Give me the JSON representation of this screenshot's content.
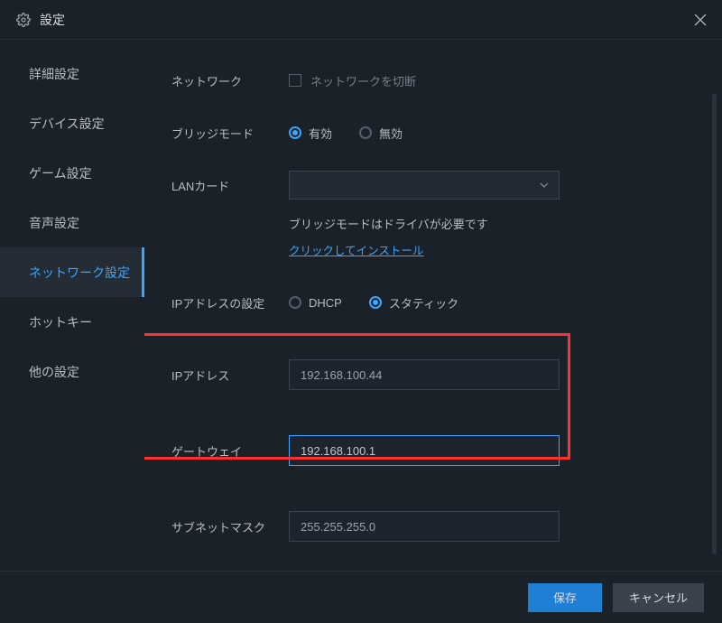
{
  "window": {
    "title": "設定"
  },
  "sidebar": {
    "items": [
      {
        "label": "詳細設定"
      },
      {
        "label": "デバイス設定"
      },
      {
        "label": "ゲーム設定"
      },
      {
        "label": "音声設定"
      },
      {
        "label": "ネットワーク設定"
      },
      {
        "label": "ホットキー"
      },
      {
        "label": "他の設定"
      }
    ],
    "activeIndex": 4
  },
  "form": {
    "network": {
      "label": "ネットワーク",
      "checkbox_label": "ネットワークを切断"
    },
    "bridge": {
      "label": "ブリッジモード",
      "options": {
        "enabled": "有効",
        "disabled": "無効"
      }
    },
    "lan": {
      "label": "LANカード",
      "selected": ""
    },
    "driver_note": "ブリッジモードはドライバが必要です",
    "install_link": "クリックしてインストール",
    "ipconfig": {
      "label": "IPアドレスの設定",
      "options": {
        "dhcp": "DHCP",
        "static": "スタティック"
      }
    },
    "ip": {
      "label": "IPアドレス",
      "value": "192.168.100.44"
    },
    "gateway": {
      "label": "ゲートウェイ",
      "value": "192.168.100.1"
    },
    "subnet": {
      "label": "サブネットマスク",
      "value": "255.255.255.0"
    }
  },
  "footer": {
    "save": "保存",
    "cancel": "キャンセル"
  }
}
